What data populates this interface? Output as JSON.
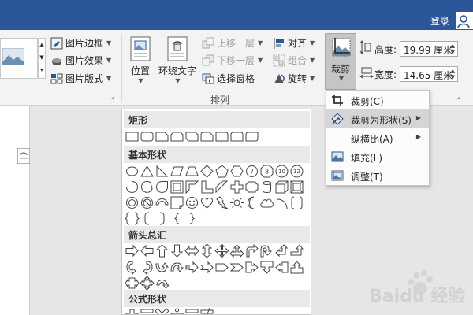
{
  "titlebar": {
    "login": "登录",
    "bg_color": "#2b579a"
  },
  "ribbon": {
    "picture_styles": {
      "border": "图片边框",
      "effects": "图片效果",
      "layout": "图片版式"
    },
    "position": "位置",
    "wrap_text": "环绕文字",
    "bring_forward": "上移一层",
    "send_backward": "下移一层",
    "selection_pane": "选择窗格",
    "align": "对齐",
    "group": "组合",
    "rotate": "旋转",
    "arrange_label": "排列",
    "crop": "裁剪",
    "height_label": "高度:",
    "height_value": "19.99 厘米",
    "width_label": "宽度:",
    "width_value": "14.65 厘米"
  },
  "crop_menu": {
    "items": [
      {
        "label": "裁剪(C)",
        "icon": "crop-icon"
      },
      {
        "label": "裁剪为形状(S)",
        "icon": "crop-shape-icon",
        "submenu": true,
        "highlighted": true
      },
      {
        "label": "纵横比(A)",
        "icon": "",
        "submenu": true
      },
      {
        "label": "填充(L)",
        "icon": "fill-icon"
      },
      {
        "label": "调整(T)",
        "icon": "fit-icon"
      }
    ]
  },
  "shapes_gallery": {
    "categories": [
      "矩形",
      "基本形状",
      "箭头总汇",
      "公式形状"
    ]
  },
  "watermark": {
    "text": "Baidu 经验"
  }
}
